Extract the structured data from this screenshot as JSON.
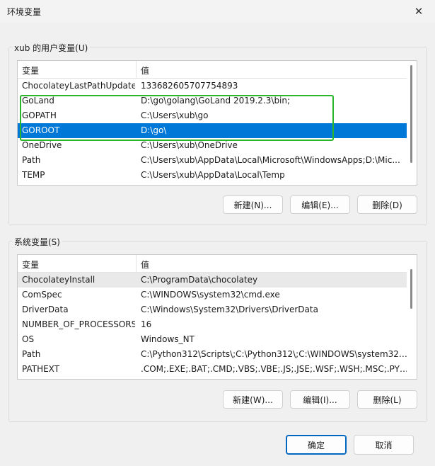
{
  "window": {
    "title": "环境变量",
    "close_glyph": "✕"
  },
  "user_vars": {
    "group_label": "xub 的用户变量(U)",
    "col_name": "变量",
    "col_value": "值",
    "rows": [
      {
        "name": "ChocolateyLastPathUpdate",
        "value": "133682605707754893"
      },
      {
        "name": "GoLand",
        "value": "D:\\go\\golang\\GoLand 2019.2.3\\bin;"
      },
      {
        "name": "GOPATH",
        "value": "C:\\Users\\xub\\go"
      },
      {
        "name": "GOROOT",
        "value": "D:\\go\\"
      },
      {
        "name": "OneDrive",
        "value": "C:\\Users\\xub\\OneDrive"
      },
      {
        "name": "Path",
        "value": "C:\\Users\\xub\\AppData\\Local\\Microsoft\\WindowsApps;D:\\Mic..."
      },
      {
        "name": "TEMP",
        "value": "C:\\Users\\xub\\AppData\\Local\\Temp"
      }
    ],
    "selected_index": 3,
    "buttons": {
      "new": "新建(N)...",
      "edit": "编辑(E)...",
      "delete": "删除(D)"
    }
  },
  "system_vars": {
    "group_label": "系统变量(S)",
    "col_name": "变量",
    "col_value": "值",
    "rows": [
      {
        "name": "ChocolateyInstall",
        "value": "C:\\ProgramData\\chocolatey"
      },
      {
        "name": "ComSpec",
        "value": "C:\\WINDOWS\\system32\\cmd.exe"
      },
      {
        "name": "DriverData",
        "value": "C:\\Windows\\System32\\Drivers\\DriverData"
      },
      {
        "name": "NUMBER_OF_PROCESSORS",
        "value": "16"
      },
      {
        "name": "OS",
        "value": "Windows_NT"
      },
      {
        "name": "Path",
        "value": "C:\\Python312\\Scripts\\;C:\\Python312\\;C:\\WINDOWS\\system32;..."
      },
      {
        "name": "PATHEXT",
        "value": ".COM;.EXE;.BAT;.CMD;.VBS;.VBE;.JS;.JSE;.WSF;.WSH;.MSC;.PY;.P..."
      }
    ],
    "hover_index": 0,
    "buttons": {
      "new": "新建(W)...",
      "edit": "编辑(I)...",
      "delete": "删除(L)"
    }
  },
  "footer": {
    "ok": "确定",
    "cancel": "取消"
  },
  "colors": {
    "selection": "#0078d7",
    "annotation_box": "#2ab52a",
    "primary_border": "#0067c0"
  }
}
